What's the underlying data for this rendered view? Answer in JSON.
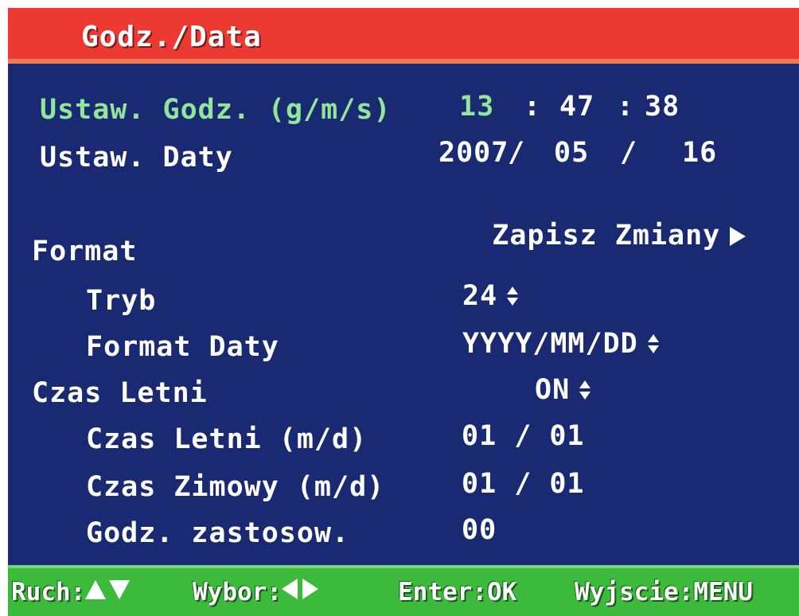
{
  "title": "Godz./Data",
  "colors": {
    "background": "#1a2a72",
    "title_bar": "#ec3a33",
    "hint_bar": "#3cba3c",
    "highlight_text": "#92e69a",
    "text": "#ffffff"
  },
  "time": {
    "label": "Ustaw. Godz. (g/m/s)",
    "hours": "13",
    "sep1": ":",
    "minutes": "47",
    "sep2": ":",
    "seconds": "38"
  },
  "date": {
    "label": "Ustaw. Daty",
    "year": "2007",
    "sep1": "/",
    "month": "05",
    "sep2": "/",
    "day": "16"
  },
  "save": {
    "label": "Zapisz Zmiany",
    "icon": "play-arrow-icon"
  },
  "format": {
    "header": "Format",
    "mode": {
      "label": "Tryb",
      "value": "24"
    },
    "date_format": {
      "label": "Format Daty",
      "value": "YYYY/MM/DD"
    }
  },
  "dst": {
    "label": "Czas Letni",
    "value": "ON",
    "summer": {
      "label": "Czas Letni (m/d)",
      "value": "01 / 01"
    },
    "winter": {
      "label": "Czas Zimowy (m/d)",
      "value": "01 / 01"
    },
    "apply_hour": {
      "label": "Godz. zastosow.",
      "value": "00"
    }
  },
  "hints": {
    "move": {
      "label": "Ruch:",
      "icons": [
        "up-arrow-icon",
        "down-arrow-icon"
      ]
    },
    "select": {
      "label": "Wybor:",
      "icons": [
        "left-arrow-icon",
        "right-arrow-icon"
      ]
    },
    "enter": "Enter:OK",
    "exit": "Wyjscie:MENU"
  }
}
